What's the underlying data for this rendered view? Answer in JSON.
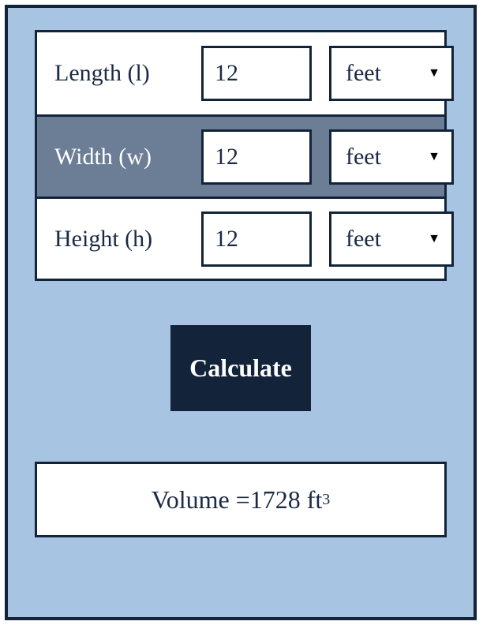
{
  "inputs": {
    "length": {
      "label": "Length (l)",
      "value": "12",
      "unit": "feet"
    },
    "width": {
      "label": "Width (w)",
      "value": "12",
      "unit": "feet"
    },
    "height": {
      "label": "Height (h)",
      "value": "12",
      "unit": "feet"
    }
  },
  "button": {
    "calculate": "Calculate"
  },
  "result": {
    "prefix": "Volume = ",
    "value": "1728",
    "unit": "ft",
    "exponent": "3"
  }
}
